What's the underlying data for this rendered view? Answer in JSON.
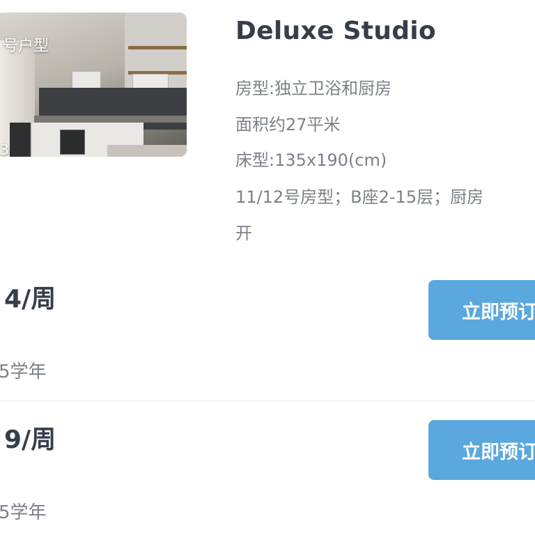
{
  "room": {
    "photo": {
      "overlay_title": "号户型",
      "overlay_count": "3",
      "description": "kitchen photo"
    },
    "title": "Deluxe Studio",
    "details": [
      "房型:独立卫浴和厨房",
      "面积约27平米",
      "床型:135x190(cm)",
      "11/12号房型；B座2-15层；厨房",
      "开"
    ]
  },
  "options": [
    {
      "price": "4/周",
      "term": "5学年",
      "button": "立即预订"
    },
    {
      "price": "9/周",
      "term": "5学年",
      "button": "立即预订"
    }
  ],
  "colors": {
    "button_bg": "#5aa8dd",
    "title_text": "#363e4b",
    "detail_text": "#7c8089"
  }
}
